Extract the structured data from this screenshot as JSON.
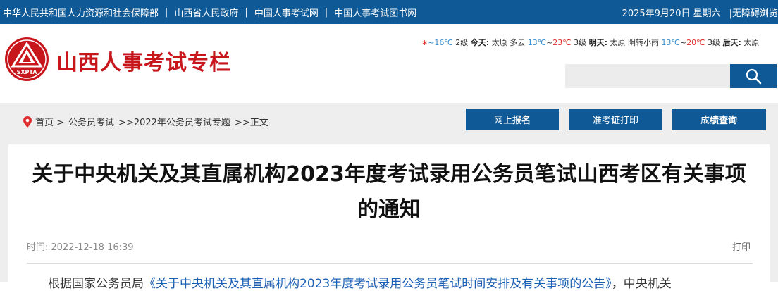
{
  "topbar": {
    "links": [
      "中华人民共和国人力资源和社会保障部",
      "山西省人民政府",
      "中国人事考试网",
      "中国人事考试图书网"
    ],
    "separator": "|",
    "date": "2025年9月20日 星期六",
    "accessibility": "|无障碍浏览"
  },
  "header": {
    "logo_text": "SXPTA",
    "site_title": "山西人事考试专栏",
    "weather": {
      "p1": "~16℃",
      "p1_wind": "2级",
      "today_label": "今天:",
      "today_city": "太原",
      "today_cond": "多云",
      "today_low": "13℃",
      "tilde": "~",
      "today_high": "23℃",
      "today_wind": "3级",
      "tomorrow_label": "明天:",
      "tomorrow_city": "太原",
      "tomorrow_cond": "阴转小雨",
      "tomorrow_low": "13℃",
      "tomorrow_high": "20℃",
      "tomorrow_wind": "3级",
      "after_label": "后天:",
      "after_city": "太原"
    },
    "search_placeholder": ""
  },
  "breadcrumb": {
    "items": [
      "首页 >",
      "公务员考试",
      ">>2022年公务员考试专题",
      ">>正文"
    ]
  },
  "nav_buttons": {
    "register": {
      "pre": "网上",
      "bold": "报名",
      "post": ""
    },
    "admission": {
      "pre": "准考",
      "bold": "证",
      "post": "打印"
    },
    "score": {
      "pre": "成",
      "bold": "绩查询",
      "post": ""
    }
  },
  "article": {
    "title": "关于中央机关及其直属机构2023年度考试录用公务员笔试山西考区有关事项的通知",
    "time_label": "时间:",
    "time_value": "2022-12-18 16:39",
    "print_label": "打印",
    "body_start": "根据国家公务员局",
    "body_link": "《关于中央机关及其直属机构2023年度考试录用公务员笔试时间安排及有关事项的公告》",
    "body_end": "，中央机关"
  },
  "colors": {
    "topbar_bg": "#0f5a96",
    "brand_red": "#c8161d",
    "button_blue": "#0f5a96"
  }
}
